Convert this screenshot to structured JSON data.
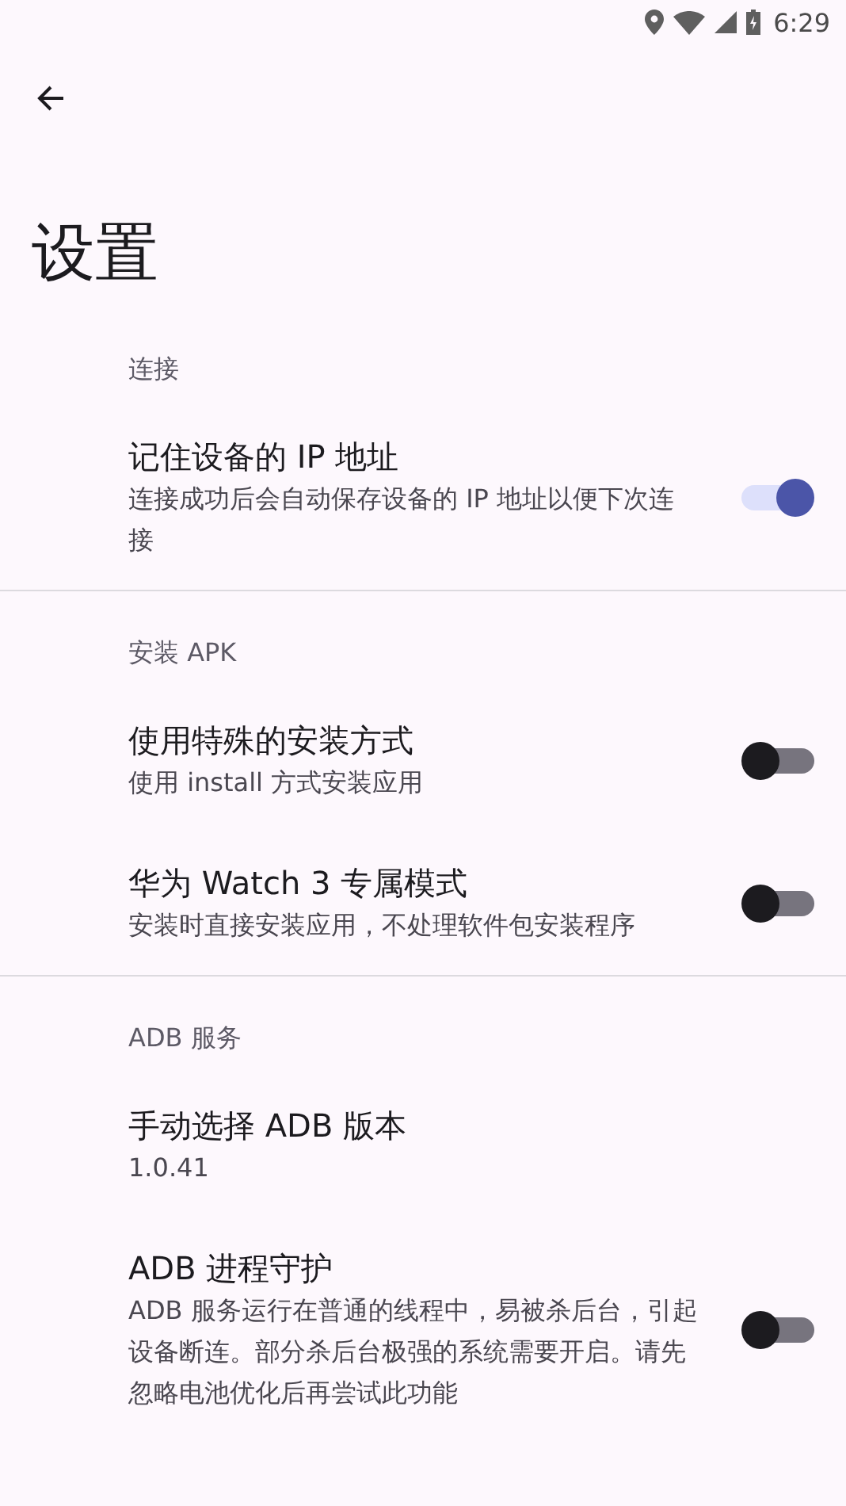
{
  "status_bar": {
    "time": "6:29"
  },
  "title": "设置",
  "sections": [
    {
      "header": "连接",
      "items": [
        {
          "kind": "switch",
          "title": "记住设备的 IP 地址",
          "subtitle": "连接成功后会自动保存设备的 IP 地址以便下次连接",
          "on": true
        }
      ]
    },
    {
      "header": "安装 APK",
      "items": [
        {
          "kind": "switch",
          "title": "使用特殊的安装方式",
          "subtitle": "使用 install 方式安装应用",
          "on": false
        },
        {
          "kind": "switch",
          "title": "华为 Watch 3 专属模式",
          "subtitle": "安装时直接安装应用，不处理软件包安装程序",
          "on": false
        }
      ]
    },
    {
      "header": "ADB 服务",
      "items": [
        {
          "kind": "value",
          "title": "手动选择 ADB 版本",
          "subtitle": "1.0.41"
        },
        {
          "kind": "switch",
          "title": "ADB 进程守护",
          "subtitle": "ADB 服务运行在普通的线程中，易被杀后台，引起设备断连。部分杀后台极强的系统需要开启。请先忽略电池优化后再尝试此功能",
          "on": false
        }
      ]
    }
  ]
}
